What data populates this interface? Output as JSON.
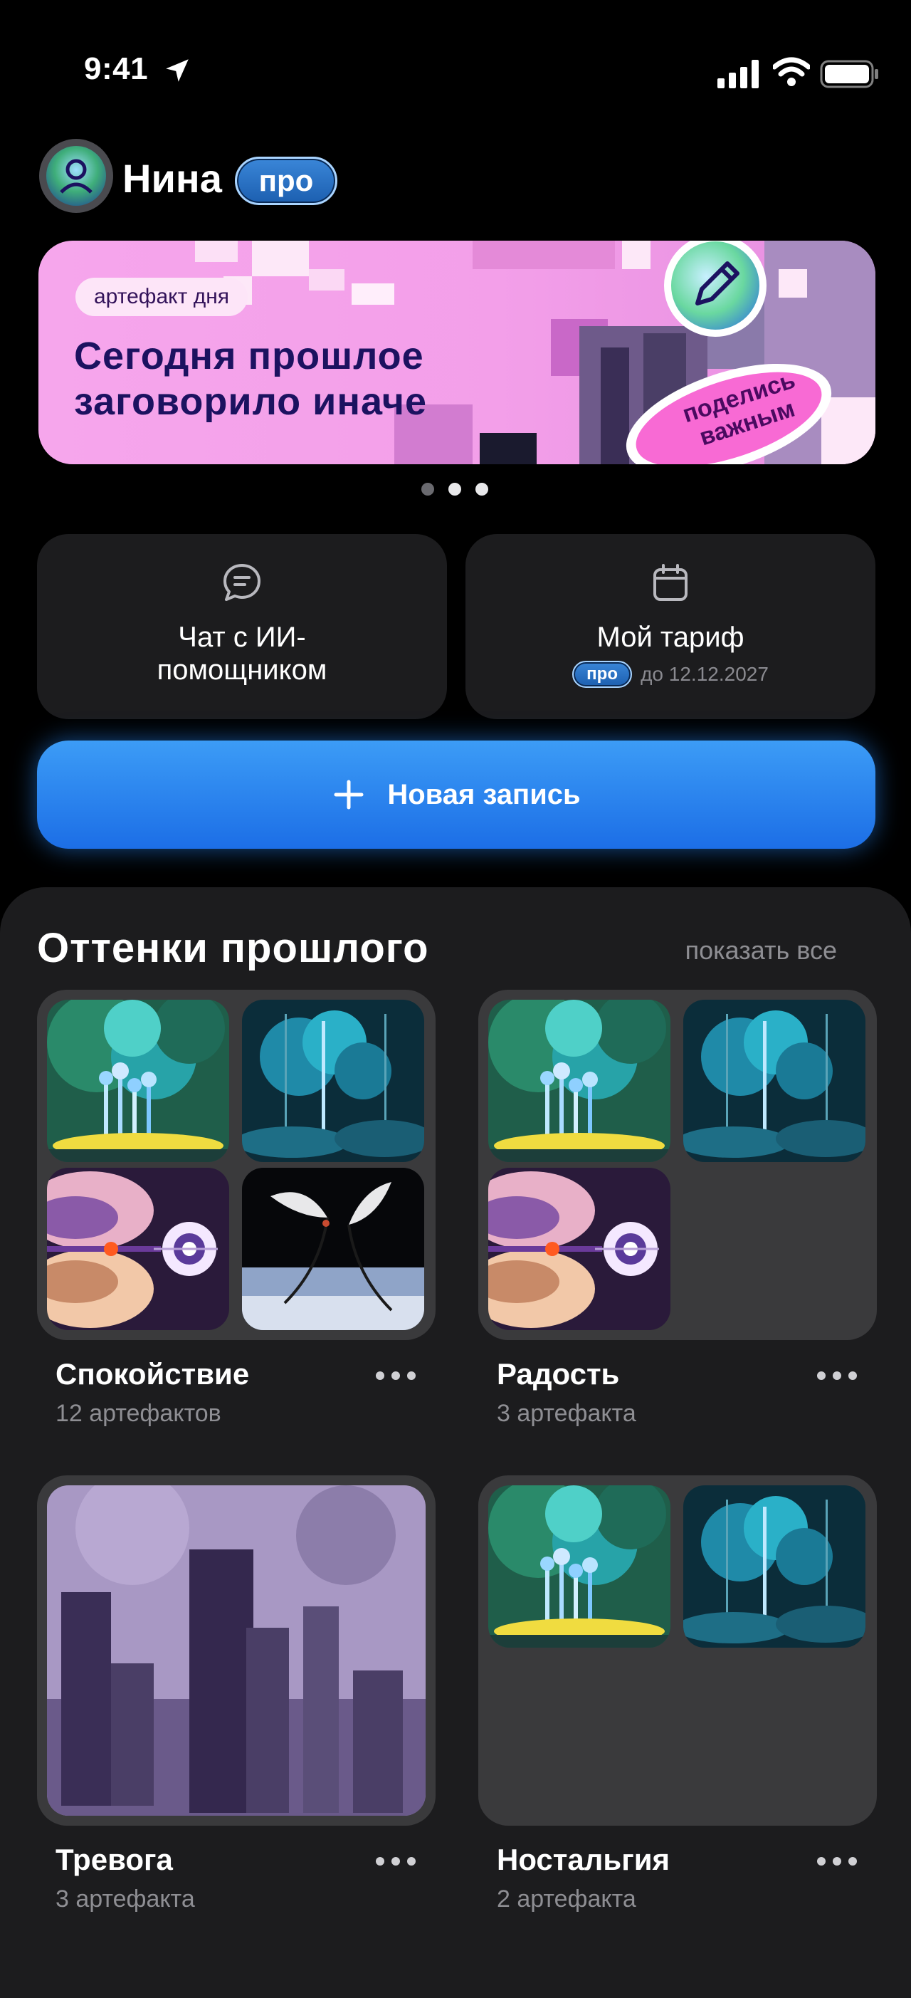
{
  "status_bar": {
    "time": "9:41"
  },
  "profile": {
    "name": "Нина",
    "badge": "про"
  },
  "banner": {
    "tag": "артефакт дня",
    "title": "Сегодня прошлое заговорило иначе",
    "sticker": "поделись важным"
  },
  "carousel": {
    "pages": 3,
    "active": 2
  },
  "actions": {
    "chat_label": "Чат с ИИ-помощником",
    "plan_label": "Мой тариф",
    "plan_badge": "про",
    "plan_until": "до 12.12.2027"
  },
  "new_entry_label": "Новая запись",
  "moods": {
    "title": "Оттенки прошлого",
    "show_all": "показать все",
    "albums": [
      {
        "name": "Спокойствие",
        "count": "12 артефактов"
      },
      {
        "name": "Радость",
        "count": "3 артефакта"
      },
      {
        "name": "Тревога",
        "count": "3 артефакта"
      },
      {
        "name": "Ностальгия",
        "count": "2 артефакта"
      }
    ]
  },
  "colors": {
    "accent": "#1c6ee6",
    "banner": "#f6a6ec",
    "panel": "#1c1c1e"
  },
  "icons": [
    "location-arrow-icon",
    "signal-icon",
    "wifi-icon",
    "battery-icon",
    "avatar-icon",
    "pencil-icon",
    "chat-icon",
    "calendar-icon",
    "plus-icon",
    "more-icon"
  ]
}
